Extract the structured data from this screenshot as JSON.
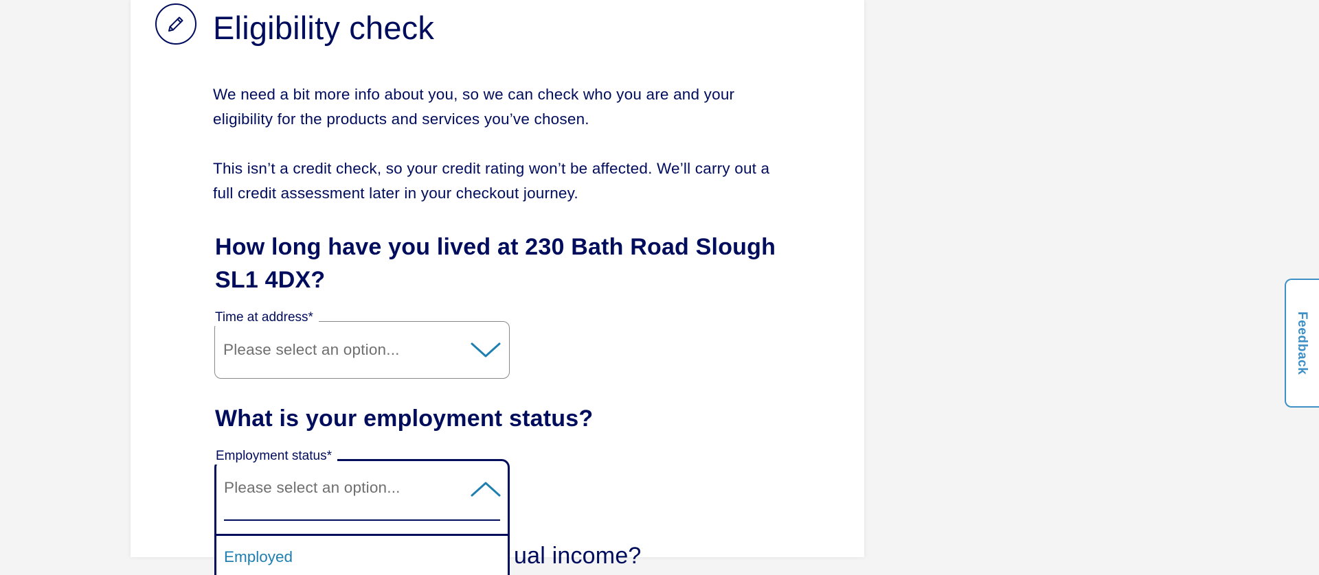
{
  "section": {
    "icon": "pencil-icon",
    "title": "Eligibility check"
  },
  "intro": {
    "paragraph_1": "We need a bit more info about you, so we can check who you are and your eligibility for the products and services you’ve chosen.",
    "paragraph_2": "This isn’t a credit check, so your credit rating won’t be affected. We’ll carry out a full credit assessment later in your checkout journey."
  },
  "address_question": {
    "heading": "How long have you lived at 230 Bath Road Slough SL1 4DX?",
    "field_label": "Time at address*",
    "placeholder": "Please select an option...",
    "state": "collapsed",
    "chevron_icon": "chevron-down-icon"
  },
  "employment_question": {
    "heading": "What is your employment status?",
    "field_label": "Employment status*",
    "placeholder": "Please select an option...",
    "state": "expanded",
    "chevron_icon": "chevron-up-icon",
    "options": [
      "Employed"
    ]
  },
  "income_question": {
    "visible_fragment": "ual income?"
  },
  "feedback": {
    "label": "Feedback"
  },
  "colors": {
    "text_navy": "#000c5c",
    "accent_blue": "#1f7fb0",
    "feedback_blue": "#3d8fc6",
    "placeholder_grey": "#6f6f6f",
    "page_background": "#f4f4f4",
    "card_background": "#ffffff"
  }
}
